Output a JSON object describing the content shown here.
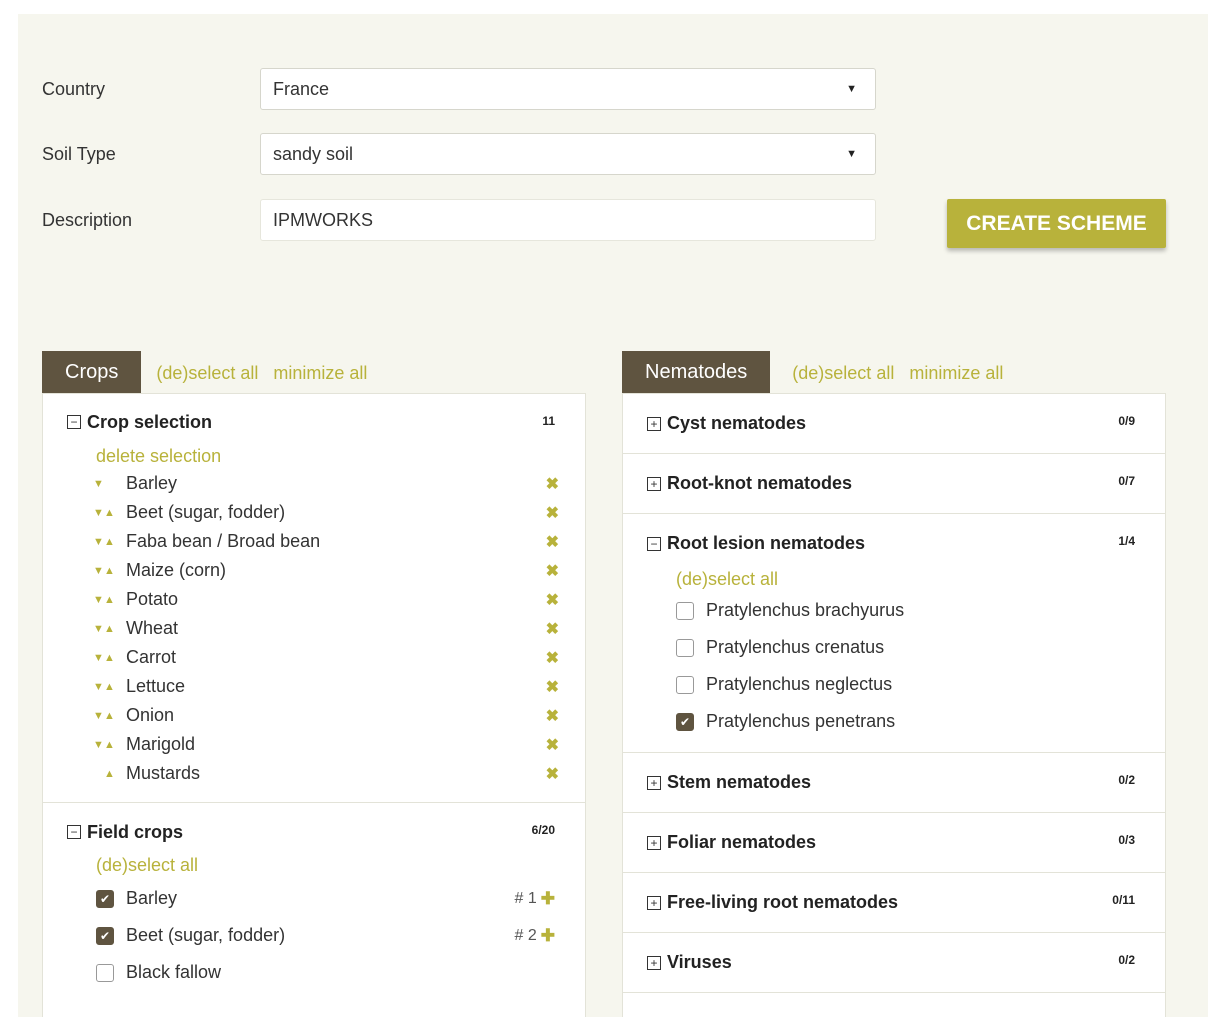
{
  "form": {
    "country_label": "Country",
    "country_value": "France",
    "soil_label": "Soil Type",
    "soil_value": "sandy soil",
    "description_label": "Description",
    "description_value": "IPMWORKS",
    "create_button": "CREATE SCHEME"
  },
  "crops_panel": {
    "tab": "Crops",
    "deselect_all": "(de)select all",
    "minimize_all": "minimize all",
    "selection": {
      "title": "Crop selection",
      "count": "11",
      "delete_label": "delete selection",
      "items": [
        {
          "name": "Barley",
          "down": true,
          "up": false
        },
        {
          "name": "Beet (sugar, fodder)",
          "down": true,
          "up": true
        },
        {
          "name": "Faba bean / Broad bean",
          "down": true,
          "up": true
        },
        {
          "name": "Maize (corn)",
          "down": true,
          "up": true
        },
        {
          "name": "Potato",
          "down": true,
          "up": true
        },
        {
          "name": "Wheat",
          "down": true,
          "up": true
        },
        {
          "name": "Carrot",
          "down": true,
          "up": true
        },
        {
          "name": "Lettuce",
          "down": true,
          "up": true
        },
        {
          "name": "Onion",
          "down": true,
          "up": true
        },
        {
          "name": "Marigold",
          "down": true,
          "up": true
        },
        {
          "name": "Mustards",
          "down": false,
          "up": true
        }
      ]
    },
    "field_crops": {
      "title": "Field crops",
      "count": "6/20",
      "deselect_all": "(de)select all",
      "items": [
        {
          "name": "Barley",
          "checked": true,
          "order": "# 1"
        },
        {
          "name": "Beet (sugar, fodder)",
          "checked": true,
          "order": "# 2"
        },
        {
          "name": "Black fallow",
          "checked": false,
          "order": ""
        }
      ]
    }
  },
  "nematodes_panel": {
    "tab": "Nematodes",
    "deselect_all": "(de)select all",
    "minimize_all": "minimize all",
    "groups": [
      {
        "title": "Cyst nematodes",
        "count": "0/9",
        "expanded": false
      },
      {
        "title": "Root-knot nematodes",
        "count": "0/7",
        "expanded": false
      },
      {
        "title": "Root lesion nematodes",
        "count": "1/4",
        "expanded": true,
        "deselect_all": "(de)select all",
        "items": [
          {
            "name": "Pratylenchus brachyurus",
            "checked": false
          },
          {
            "name": "Pratylenchus crenatus",
            "checked": false
          },
          {
            "name": "Pratylenchus neglectus",
            "checked": false
          },
          {
            "name": "Pratylenchus penetrans",
            "checked": true
          }
        ]
      },
      {
        "title": "Stem nematodes",
        "count": "0/2",
        "expanded": false
      },
      {
        "title": "Foliar nematodes",
        "count": "0/3",
        "expanded": false
      },
      {
        "title": "Free-living root nematodes",
        "count": "0/11",
        "expanded": false
      },
      {
        "title": "Viruses",
        "count": "0/2",
        "expanded": false
      }
    ]
  },
  "icons": {
    "dropdown": "caret-down-icon",
    "expanded": "minus-square-icon",
    "collapsed": "plus-square-icon",
    "remove": "cross-icon",
    "add": "plus-icon",
    "check": "check-icon"
  },
  "colors": {
    "accent": "#b8b23b",
    "tab": "#5f5440",
    "background": "#f6f6ee"
  }
}
